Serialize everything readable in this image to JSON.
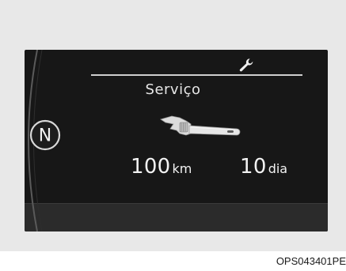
{
  "display": {
    "title": "Serviço",
    "gear": "N",
    "distance": {
      "value": "100",
      "unit": "km"
    },
    "days": {
      "value": "10",
      "unit": "dia"
    },
    "top_icon": "wrench-icon",
    "main_icon": "adjustable-wrench-icon"
  },
  "figure_code": "OPS043401PE",
  "colors": {
    "panel_bg": "#e8e8e8",
    "screen_bg": "#171717",
    "text": "#f2f2f2"
  }
}
